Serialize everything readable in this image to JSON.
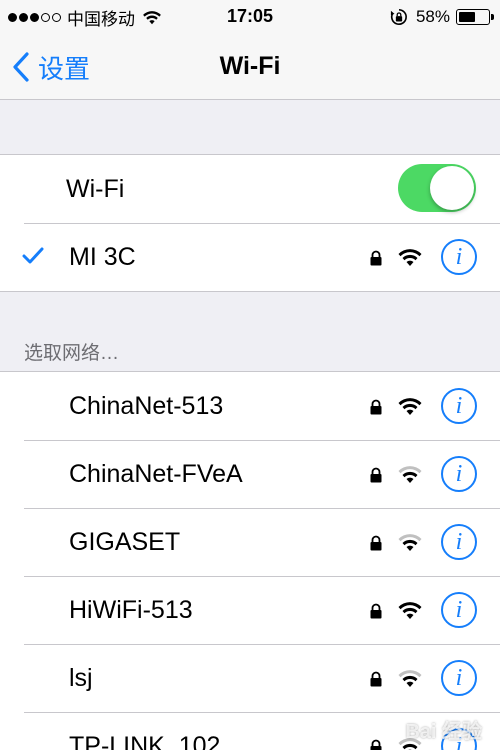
{
  "status_bar": {
    "signal_filled": 3,
    "signal_total": 5,
    "carrier": "中国移动",
    "time": "17:05",
    "battery_percent_label": "58%",
    "battery_level": 0.58
  },
  "nav": {
    "back_label": "设置",
    "title": "Wi-Fi"
  },
  "wifi_toggle": {
    "label": "Wi-Fi",
    "on": true
  },
  "connected": {
    "name": "MI 3C",
    "secured": true,
    "signal": "full",
    "info_label": "i"
  },
  "section_header": "选取网络…",
  "networks": [
    {
      "name": "ChinaNet-513",
      "secured": true,
      "signal": "full",
      "info_label": "i"
    },
    {
      "name": "ChinaNet-FVeA",
      "secured": true,
      "signal": "medium",
      "info_label": "i"
    },
    {
      "name": "GIGASET",
      "secured": true,
      "signal": "medium",
      "info_label": "i"
    },
    {
      "name": "HiWiFi-513",
      "secured": true,
      "signal": "full",
      "info_label": "i"
    },
    {
      "name": "lsj",
      "secured": true,
      "signal": "medium",
      "info_label": "i"
    },
    {
      "name": "TP-LINK_102",
      "secured": true,
      "signal": "medium",
      "info_label": "i"
    }
  ],
  "colors": {
    "accent": "#157efb",
    "toggle_on": "#4cd964",
    "background": "#efeff4"
  },
  "watermark": "Bai 经验"
}
